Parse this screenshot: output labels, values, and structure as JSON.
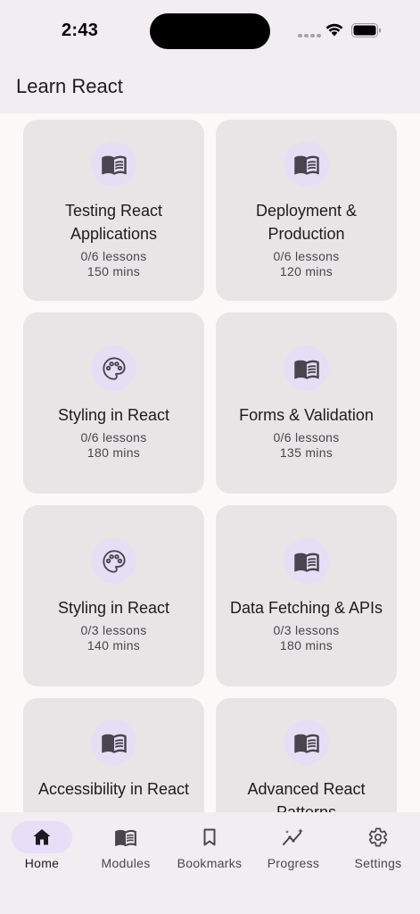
{
  "status_bar": {
    "time": "2:43"
  },
  "app_bar": {
    "title": "Learn React"
  },
  "modules": [
    {
      "title": "Testing React Applications",
      "lessons": "0/6 lessons",
      "duration": "150 mins",
      "icon": "book-icon"
    },
    {
      "title": "Deployment & Production",
      "lessons": "0/6 lessons",
      "duration": "120 mins",
      "icon": "book-icon"
    },
    {
      "title": "Styling in React",
      "lessons": "0/6 lessons",
      "duration": "180 mins",
      "icon": "palette-icon"
    },
    {
      "title": "Forms & Validation",
      "lessons": "0/6 lessons",
      "duration": "135 mins",
      "icon": "book-icon"
    },
    {
      "title": "Styling in React",
      "lessons": "0/3 lessons",
      "duration": "140 mins",
      "icon": "palette-icon"
    },
    {
      "title": "Data Fetching & APIs",
      "lessons": "0/3 lessons",
      "duration": "180 mins",
      "icon": "book-icon"
    },
    {
      "title": "Accessibility in React",
      "lessons": "",
      "duration": "",
      "icon": "book-icon"
    },
    {
      "title": "Advanced React Patterns",
      "lessons": "",
      "duration": "",
      "icon": "book-icon"
    }
  ],
  "bottom_nav": {
    "items": [
      {
        "label": "Home",
        "icon": "home-icon",
        "active": true
      },
      {
        "label": "Modules",
        "icon": "book-icon",
        "active": false
      },
      {
        "label": "Bookmarks",
        "icon": "bookmark-icon",
        "active": false
      },
      {
        "label": "Progress",
        "icon": "progress-icon",
        "active": false
      },
      {
        "label": "Settings",
        "icon": "gear-icon",
        "active": false
      }
    ]
  },
  "colors": {
    "background": "#fcf8f8",
    "app_bar": "#f1edf0",
    "card": "#e9e5e6",
    "icon_circle": "#e5dff5",
    "active_indicator": "#e8def8",
    "text_primary": "#1d1b20",
    "text_secondary": "#49454f"
  }
}
